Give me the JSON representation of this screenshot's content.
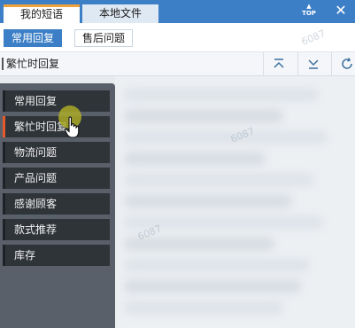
{
  "titlebar": {
    "tabs": [
      {
        "label": "我的短语"
      },
      {
        "label": "本地文件"
      }
    ],
    "top_label": "TOP",
    "close_icon": "close-icon"
  },
  "subtabs": [
    {
      "label": "常用回复",
      "selected": true
    },
    {
      "label": "售后问题",
      "selected": false
    }
  ],
  "toolbar": {
    "group_label": "繁忙时回复",
    "buttons": [
      "move-to-top-icon",
      "move-to-bottom-icon",
      "refresh-icon"
    ]
  },
  "watermark_text": "6087",
  "menu": {
    "items": [
      {
        "label": "常用回复",
        "active": false
      },
      {
        "label": "繁忙时回复",
        "active": true
      },
      {
        "label": "物流问题",
        "active": false
      },
      {
        "label": "产品问题",
        "active": false
      },
      {
        "label": "感谢顾客",
        "active": false
      },
      {
        "label": "款式推荐",
        "active": false
      },
      {
        "label": "库存",
        "active": false
      }
    ]
  },
  "colors": {
    "accent": "#3d7fc6",
    "active_marker": "#e65a2a",
    "tab_marker": "#f0a33a",
    "menu_bg": "#2f3439"
  }
}
